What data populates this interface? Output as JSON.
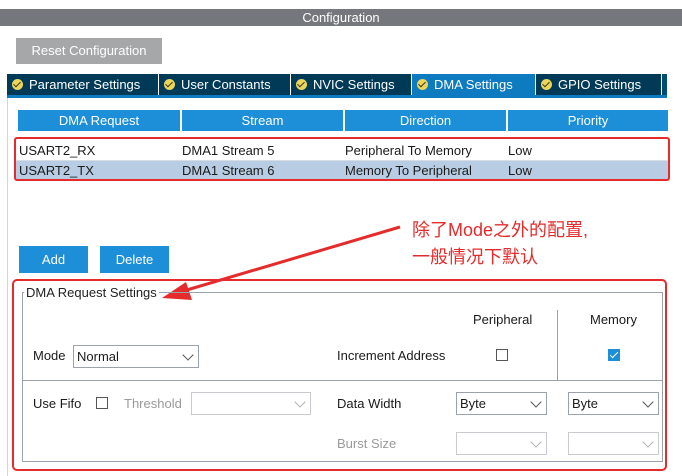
{
  "window": {
    "title": "Configuration"
  },
  "toolbar": {
    "reset_label": "Reset Configuration"
  },
  "tabs": [
    {
      "label": "Parameter Settings",
      "icon": "check-circle-icon",
      "active": false
    },
    {
      "label": "User Constants",
      "icon": "check-circle-icon",
      "active": false
    },
    {
      "label": "NVIC Settings",
      "icon": "check-circle-icon",
      "active": false
    },
    {
      "label": "DMA Settings",
      "icon": "check-circle-icon",
      "active": true
    },
    {
      "label": "GPIO Settings",
      "icon": "check-circle-icon",
      "active": false
    }
  ],
  "dma_table": {
    "headers": [
      "DMA Request",
      "Stream",
      "Direction",
      "Priority"
    ],
    "rows": [
      [
        "USART2_RX",
        "DMA1 Stream 5",
        "Peripheral To Memory",
        "Low"
      ],
      [
        "USART2_TX",
        "DMA1 Stream 6",
        "Memory To Peripheral",
        "Low"
      ]
    ],
    "selected_row": 1
  },
  "buttons": {
    "add": "Add",
    "delete": "Delete"
  },
  "annotation": {
    "line1": "除了Mode之外的配置,",
    "line2": "一般情况下默认"
  },
  "settings": {
    "group_title": "DMA Request Settings",
    "mode_label": "Mode",
    "mode_value": "Normal",
    "peripheral_header": "Peripheral",
    "memory_header": "Memory",
    "increment_label": "Increment Address",
    "increment_peripheral": false,
    "increment_memory": true,
    "use_fifo_label": "Use Fifo",
    "use_fifo": false,
    "threshold_label": "Threshold",
    "threshold_value": "",
    "data_width_label": "Data Width",
    "data_width_peripheral": "Byte",
    "data_width_memory": "Byte",
    "burst_size_label": "Burst Size",
    "burst_peripheral": "",
    "burst_memory": ""
  },
  "colors": {
    "accent": "#1d8ed8",
    "tab_bg": "#003a57",
    "tab_active": "#0e7ac0",
    "highlight_red": "#e52b2b",
    "selected_row": "#b8cde3"
  }
}
